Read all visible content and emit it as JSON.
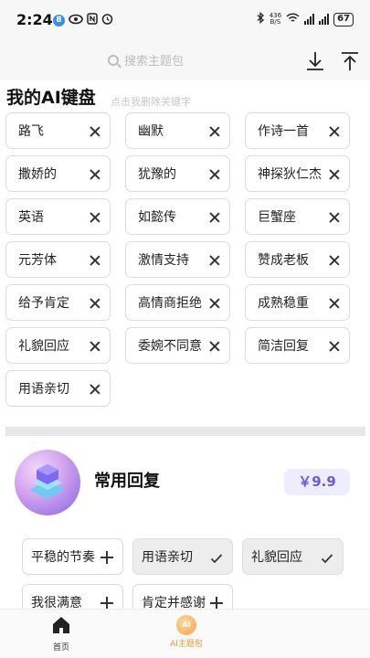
{
  "status_bar": {
    "time": "2:24",
    "notification_badge": "8",
    "network_speed_value": "436",
    "network_speed_unit": "B/S",
    "battery": "67"
  },
  "search": {
    "placeholder": "搜索主题包"
  },
  "keyboard_section": {
    "title": "我的AI键盘",
    "hint": "点击我删除关键字",
    "chips": [
      {
        "label": "路飞"
      },
      {
        "label": "幽默"
      },
      {
        "label": "作诗一首"
      },
      {
        "label": "撒娇的"
      },
      {
        "label": "犹豫的"
      },
      {
        "label": "神探狄仁杰"
      },
      {
        "label": "英语"
      },
      {
        "label": "如懿传"
      },
      {
        "label": "巨蟹座"
      },
      {
        "label": "元芳体"
      },
      {
        "label": "激情支持"
      },
      {
        "label": "赞成老板"
      },
      {
        "label": "给予肯定"
      },
      {
        "label": "高情商拒绝"
      },
      {
        "label": "成熟稳重"
      },
      {
        "label": "礼貌回应"
      },
      {
        "label": "委婉不同意"
      },
      {
        "label": "简洁回复"
      },
      {
        "label": "用语亲切"
      }
    ]
  },
  "package": {
    "title": "常用回复",
    "price": "￥9.9",
    "accent_color": "#6b5cd6",
    "items": [
      {
        "label": "平稳的节奏",
        "selected": false
      },
      {
        "label": "用语亲切",
        "selected": true
      },
      {
        "label": "礼貌回应",
        "selected": true
      },
      {
        "label": "我很满意",
        "selected": false
      },
      {
        "label": "肯定并感谢",
        "selected": false
      }
    ]
  },
  "bottom_nav": {
    "home_label": "首页",
    "ai_label": "AI主题包",
    "ai_icon_text": "AI",
    "active_color": "#e8962d"
  }
}
